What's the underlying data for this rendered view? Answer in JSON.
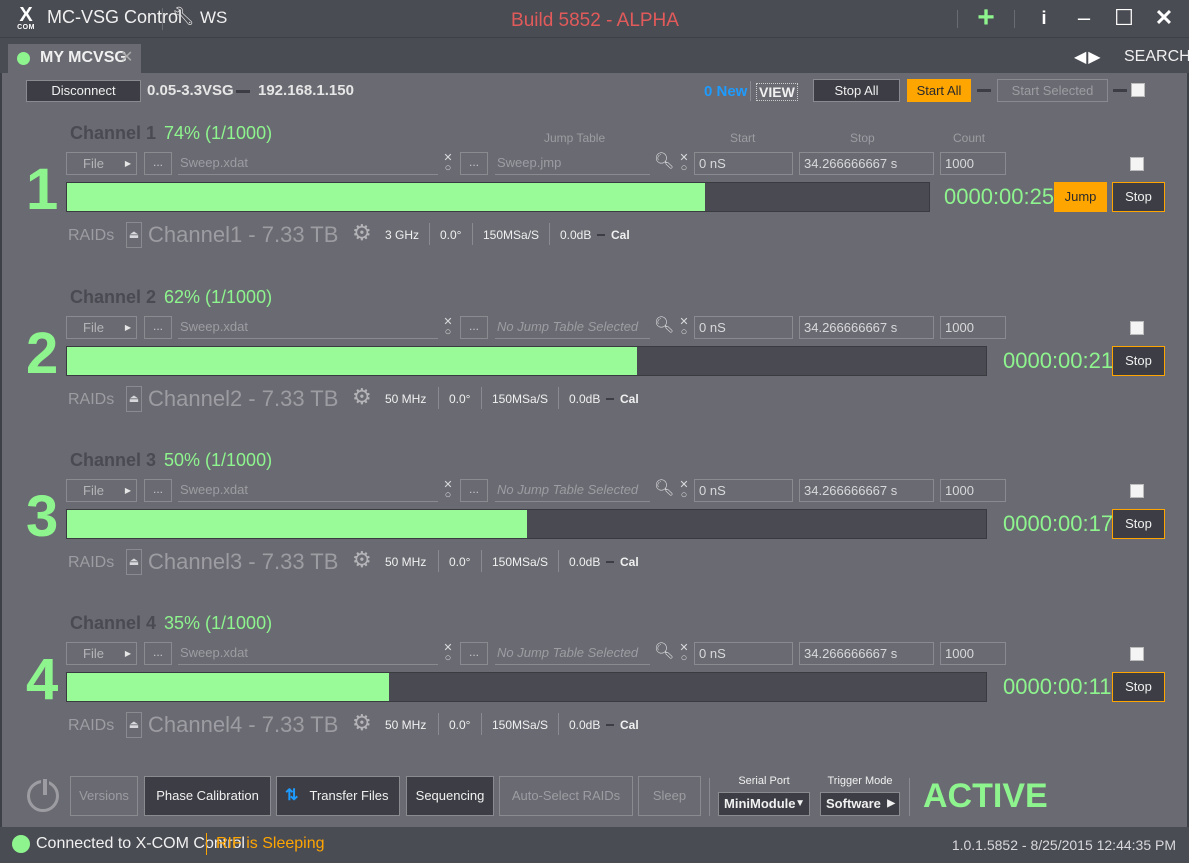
{
  "titlebar": {
    "app_title": "MC-VSG Control",
    "workspace": "WS",
    "build": "Build 5852 - ALPHA",
    "logo_text": "X",
    "logo_sub": "COM"
  },
  "tabbar": {
    "tab_label": "MY MCVSG",
    "search_label": "SEARCH"
  },
  "toolbar": {
    "disconnect": "Disconnect",
    "device_range": "0.05-3.3VSG",
    "ip": "192.168.1.150",
    "new_count": "0 New",
    "view": "VIEW",
    "stop_all": "Stop All",
    "start_all": "Start All",
    "start_selected": "Start Selected"
  },
  "column_headers": {
    "jump_table": "Jump Table",
    "start": "Start",
    "stop": "Stop",
    "count": "Count"
  },
  "channels": [
    {
      "number": "1",
      "title": "Channel 1",
      "progress_text": "74% (1/1000)",
      "progress": 0.74,
      "file_button": "File",
      "file_path": "Sweep.xdat",
      "jump_table": "Sweep.jmp",
      "start": "0 nS",
      "stop": "34.266666667 s",
      "count": "1000",
      "timer": "0000:00:25",
      "jump_button": "Jump",
      "stop_button": "Stop",
      "raids_label": "RAIDs",
      "drive": "Channel1 - 7.33 TB",
      "freq": "3 GHz",
      "phase": "0.0°",
      "rate": "150MSa/S",
      "gain": "0.0dB",
      "cal": "Cal"
    },
    {
      "number": "2",
      "title": "Channel 2",
      "progress_text": "62% (1/1000)",
      "progress": 0.62,
      "file_button": "File",
      "file_path": "Sweep.xdat",
      "jump_table": "No Jump Table Selected",
      "start": "0 nS",
      "stop": "34.266666667 s",
      "count": "1000",
      "timer": "0000:00:21",
      "stop_button": "Stop",
      "raids_label": "RAIDs",
      "drive": "Channel2 - 7.33 TB",
      "freq": "50 MHz",
      "phase": "0.0°",
      "rate": "150MSa/S",
      "gain": "0.0dB",
      "cal": "Cal"
    },
    {
      "number": "3",
      "title": "Channel 3",
      "progress_text": "50% (1/1000)",
      "progress": 0.5,
      "file_button": "File",
      "file_path": "Sweep.xdat",
      "jump_table": "No Jump Table Selected",
      "start": "0 nS",
      "stop": "34.266666667 s",
      "count": "1000",
      "timer": "0000:00:17",
      "stop_button": "Stop",
      "raids_label": "RAIDs",
      "drive": "Channel3 - 7.33 TB",
      "freq": "50 MHz",
      "phase": "0.0°",
      "rate": "150MSa/S",
      "gain": "0.0dB",
      "cal": "Cal"
    },
    {
      "number": "4",
      "title": "Channel 4",
      "progress_text": "35% (1/1000)",
      "progress": 0.35,
      "file_button": "File",
      "file_path": "Sweep.xdat",
      "jump_table": "No Jump Table Selected",
      "start": "0 nS",
      "stop": "34.266666667 s",
      "count": "1000",
      "timer": "0000:00:11",
      "stop_button": "Stop",
      "raids_label": "RAIDs",
      "drive": "Channel4 - 7.33 TB",
      "freq": "50 MHz",
      "phase": "0.0°",
      "rate": "150MSa/S",
      "gain": "0.0dB",
      "cal": "Cal"
    }
  ],
  "bottom": {
    "versions": "Versions",
    "phase_calibration": "Phase Calibration",
    "transfer_files": "Transfer Files",
    "sequencing": "Sequencing",
    "auto_select_raids": "Auto-Select RAIDs",
    "sleep": "Sleep",
    "serial_port_label": "Serial Port",
    "serial_port_value": "MiniModule",
    "trigger_mode_label": "Trigger Mode",
    "trigger_mode_value": "Software",
    "state": "ACTIVE"
  },
  "statusbar": {
    "connection": "Connected to X-COM Control",
    "rif_status": "RIF is Sleeping",
    "version": "1.0.1.5852 - 8/25/2015 12:44:35 PM"
  },
  "colors": {
    "accent_green": "#8ef58e",
    "accent_orange": "#ffa500",
    "build_red": "#e25a5a",
    "new_blue": "#1e9bff"
  }
}
